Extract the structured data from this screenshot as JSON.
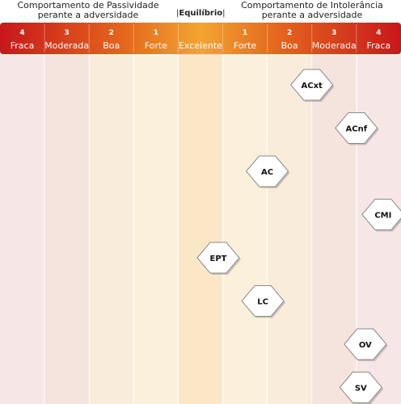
{
  "header": {
    "left_line1": "Comportamento de Passividade",
    "left_line2": "perante a adversidade",
    "center_label": "Equilíbrio",
    "right_line1": "Comportamento de Intolerância",
    "right_line2": "perante a adversidade"
  },
  "chart_data": {
    "type": "scatter",
    "categories": [
      {
        "level": "4",
        "label": "Fraca"
      },
      {
        "level": "3",
        "label": "Moderada"
      },
      {
        "level": "2",
        "label": "Boa"
      },
      {
        "level": "1",
        "label": "Forte"
      },
      {
        "level": "",
        "label": "Excelente"
      },
      {
        "level": "1",
        "label": "Forte"
      },
      {
        "level": "2",
        "label": "Boa"
      },
      {
        "level": "3",
        "label": "Moderada"
      },
      {
        "level": "4",
        "label": "Fraca"
      }
    ],
    "column_colors": [
      "#f7e6e6",
      "#f5e3dd",
      "#f9ecdb",
      "#fbf0dc",
      "#fbe7c5",
      "#fbf0dc",
      "#f9ecdb",
      "#f5e3dd",
      "#f7e6e6"
    ],
    "points": [
      {
        "label": "ACxt",
        "x": 7.0
      },
      {
        "label": "ACnf",
        "x": 8.0
      },
      {
        "label": "AC",
        "x": 6.0
      },
      {
        "label": "CMI",
        "x": 8.6
      },
      {
        "label": "EPT",
        "x": 4.9
      },
      {
        "label": "LC",
        "x": 5.9
      },
      {
        "label": "OV",
        "x": 8.2
      },
      {
        "label": "SV",
        "x": 8.1
      }
    ]
  }
}
